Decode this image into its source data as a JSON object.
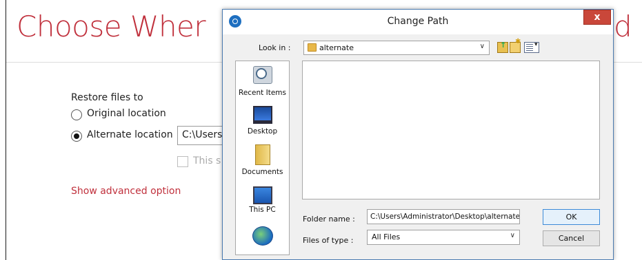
{
  "background": {
    "title": "Choose Wher",
    "title_tail": "d",
    "restore_label": "Restore files to",
    "option_original": "Original location",
    "option_alternate": "Alternate location",
    "alternate_path_value": "C:\\Users",
    "checkbox_label": "This s",
    "advanced_link": "Show advanced option"
  },
  "dialog": {
    "title": "Change Path",
    "close_label": "x",
    "look_in_label": "Look in :",
    "look_in_value": "alternate",
    "places": {
      "recent": "Recent Items",
      "desktop": "Desktop",
      "documents": "Documents",
      "this_pc": "This PC"
    },
    "folder_name_label": "Folder name :",
    "folder_name_value": "C:\\Users\\Administrator\\Desktop\\alternate",
    "files_of_type_label": "Files of type :",
    "files_of_type_value": "All Files",
    "ok_label": "OK",
    "cancel_label": "Cancel"
  },
  "colors": {
    "accent_red": "#c0303c",
    "close_button": "#c9473a",
    "dialog_border": "#4a7ab0"
  }
}
